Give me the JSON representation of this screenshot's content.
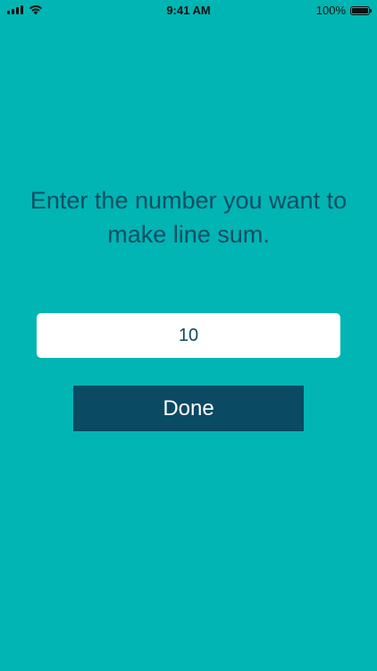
{
  "status_bar": {
    "time": "9:41 AM",
    "battery_percent": "100%",
    "signal_icon": "cellular-signal-icon",
    "wifi_icon": "wifi-icon",
    "battery_icon": "battery-icon",
    "battery_level": 1.0
  },
  "main": {
    "prompt": "Enter the number you want to make line sum.",
    "number_value": "10",
    "done_label": "Done"
  },
  "colors": {
    "background": "#00B5B3",
    "text": "#0E4D64",
    "button": "#0A4A62",
    "field": "#FFFFFF"
  }
}
